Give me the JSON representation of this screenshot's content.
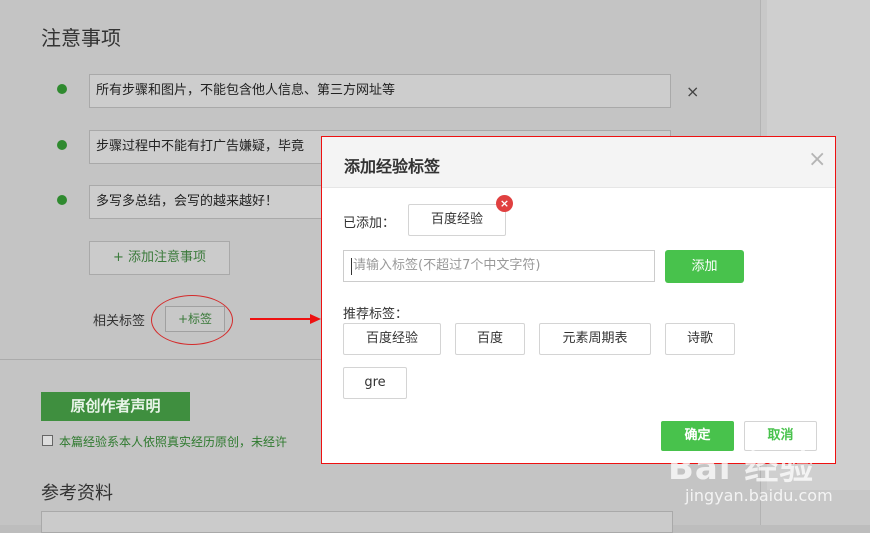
{
  "notes": {
    "heading": "注意事项",
    "items": [
      "所有步骤和图片，不能包含他人信息、第三方网址等",
      "步骤过程中不能有打广告嫌疑，毕竟",
      "多写多总结，会写的越来越好！"
    ],
    "remove_icon": "×",
    "add_label": "+ 添加注意事项"
  },
  "tags": {
    "label": "相关标签",
    "button": "+标签"
  },
  "author": {
    "badge": "原创作者声明",
    "declaration": "本篇经验系本人依照真实经历原创，未经许"
  },
  "references": {
    "heading": "参考资料"
  },
  "modal": {
    "title": "添加经验标签",
    "close_icon": "×",
    "added_label": "已添加：",
    "added_tags": [
      "百度经验"
    ],
    "chip_remove_icon": "×",
    "input_placeholder": "请输入标签(不超过7个中文字符)",
    "add_button": "添加",
    "recommend_label": "推荐标签：",
    "recommended": [
      "百度经验",
      "百度",
      "元素周期表",
      "诗歌",
      "gre"
    ],
    "ok_button": "确定",
    "cancel_button": "取消"
  },
  "watermark": {
    "logo": "Bai 经验",
    "url": "jingyan.baidu.com"
  },
  "colors": {
    "accent": "#48c24c",
    "highlight": "#e11111",
    "dark_green": "#3f8f3f"
  }
}
